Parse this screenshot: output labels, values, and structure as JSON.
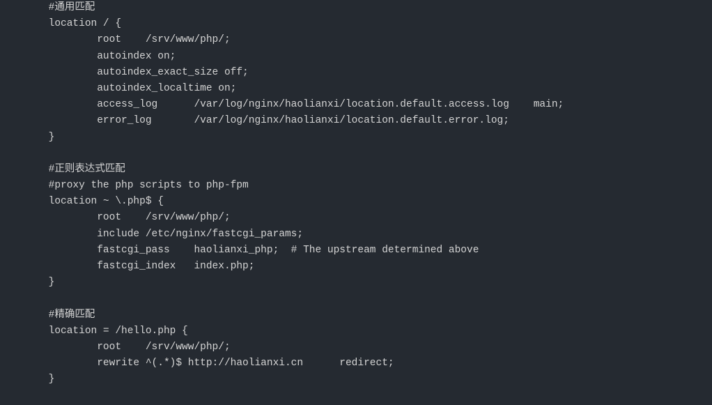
{
  "code": {
    "lines": [
      "        #通用匹配",
      "        location / {",
      "                root    /srv/www/php/;",
      "                autoindex on;",
      "                autoindex_exact_size off;",
      "                autoindex_localtime on;",
      "                access_log      /var/log/nginx/haolianxi/location.default.access.log    main;",
      "                error_log       /var/log/nginx/haolianxi/location.default.error.log;",
      "        }",
      "",
      "        #正则表达式匹配",
      "        #proxy the php scripts to php-fpm",
      "        location ~ \\.php$ {",
      "                root    /srv/www/php/;",
      "                include /etc/nginx/fastcgi_params;",
      "                fastcgi_pass    haolianxi_php;  # The upstream determined above",
      "                fastcgi_index   index.php;",
      "        }",
      "",
      "        #精确匹配",
      "        location = /hello.php {",
      "                root    /srv/www/php/;",
      "                rewrite ^(.*)$ http://haolianxi.cn      redirect;",
      "        }"
    ]
  }
}
